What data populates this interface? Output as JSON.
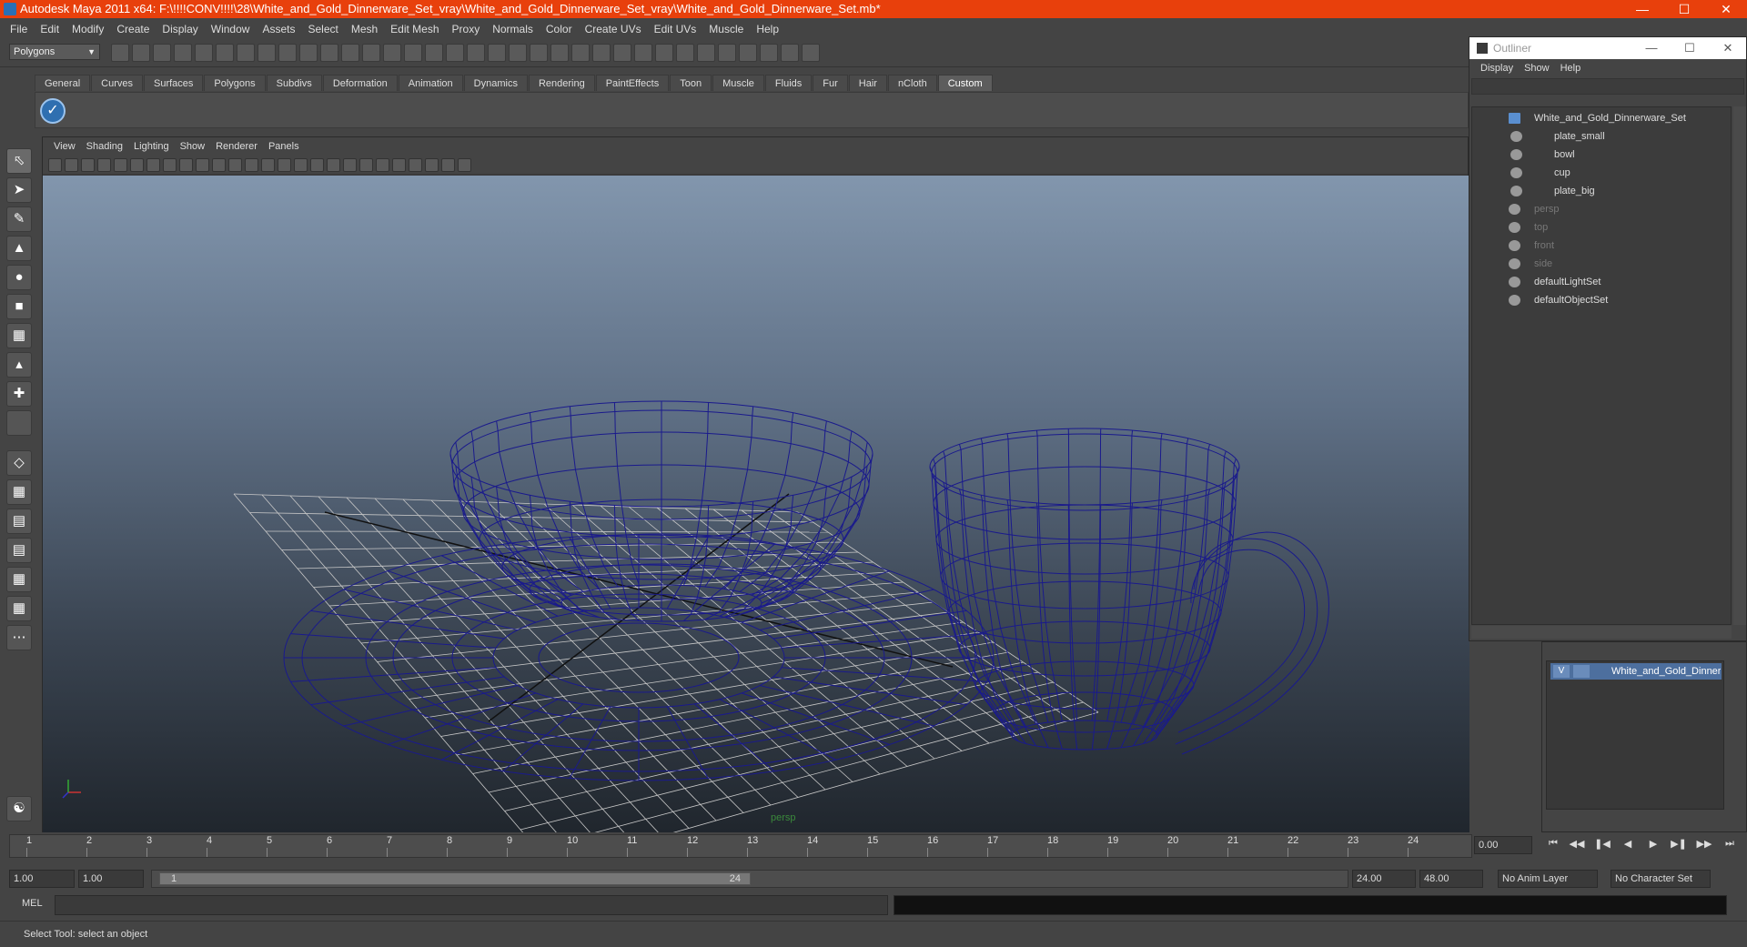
{
  "window": {
    "title": "Autodesk Maya 2011 x64: F:\\!!!!CONV!!!!\\28\\White_and_Gold_Dinnerware_Set_vray\\White_and_Gold_Dinnerware_Set_vray\\White_and_Gold_Dinnerware_Set.mb*"
  },
  "menubar": [
    "File",
    "Edit",
    "Modify",
    "Create",
    "Display",
    "Window",
    "Assets",
    "Select",
    "Mesh",
    "Edit Mesh",
    "Proxy",
    "Normals",
    "Color",
    "Create UVs",
    "Edit UVs",
    "Muscle",
    "Help"
  ],
  "statusline": {
    "mode": "Polygons"
  },
  "shelf": {
    "tabs": [
      "General",
      "Curves",
      "Surfaces",
      "Polygons",
      "Subdivs",
      "Deformation",
      "Animation",
      "Dynamics",
      "Rendering",
      "PaintEffects",
      "Toon",
      "Muscle",
      "Fluids",
      "Fur",
      "Hair",
      "nCloth",
      "Custom"
    ],
    "active": "Custom"
  },
  "panel": {
    "menu": [
      "View",
      "Shading",
      "Lighting",
      "Show",
      "Renderer",
      "Panels"
    ],
    "camera": "persp"
  },
  "outliner": {
    "title": "Outliner",
    "menu": [
      "Display",
      "Show",
      "Help"
    ],
    "items": [
      {
        "label": "White_and_Gold_Dinnerware_Set",
        "dim": false
      },
      {
        "label": "plate_small",
        "dim": false
      },
      {
        "label": "bowl",
        "dim": false
      },
      {
        "label": "cup",
        "dim": false
      },
      {
        "label": "plate_big",
        "dim": false
      },
      {
        "label": "persp",
        "dim": true
      },
      {
        "label": "top",
        "dim": true
      },
      {
        "label": "front",
        "dim": true
      },
      {
        "label": "side",
        "dim": true
      },
      {
        "label": "defaultLightSet",
        "dim": false
      },
      {
        "label": "defaultObjectSet",
        "dim": false
      }
    ]
  },
  "layer": {
    "visible": "V",
    "name": "White_and_Gold_Dinnerware"
  },
  "timeline": {
    "ticks": [
      "1",
      "2",
      "3",
      "4",
      "5",
      "6",
      "7",
      "8",
      "9",
      "10",
      "11",
      "12",
      "13",
      "14",
      "15",
      "16",
      "17",
      "18",
      "19",
      "20",
      "21",
      "22",
      "23",
      "24"
    ],
    "current_frame": "0.00"
  },
  "range": {
    "start": "1.00",
    "playstart": "1.00",
    "handle_start": "1",
    "handle_end": "24",
    "end": "24.00",
    "playend": "48.00",
    "anim_layer": "No Anim Layer",
    "character_set": "No Character Set"
  },
  "cmd": {
    "label": "MEL"
  },
  "help": {
    "text": "Select Tool: select an object"
  },
  "colors": {
    "title_bar": "#e8400c",
    "wireframe": "#1a1a8c",
    "grid": "#c8c8c8"
  }
}
